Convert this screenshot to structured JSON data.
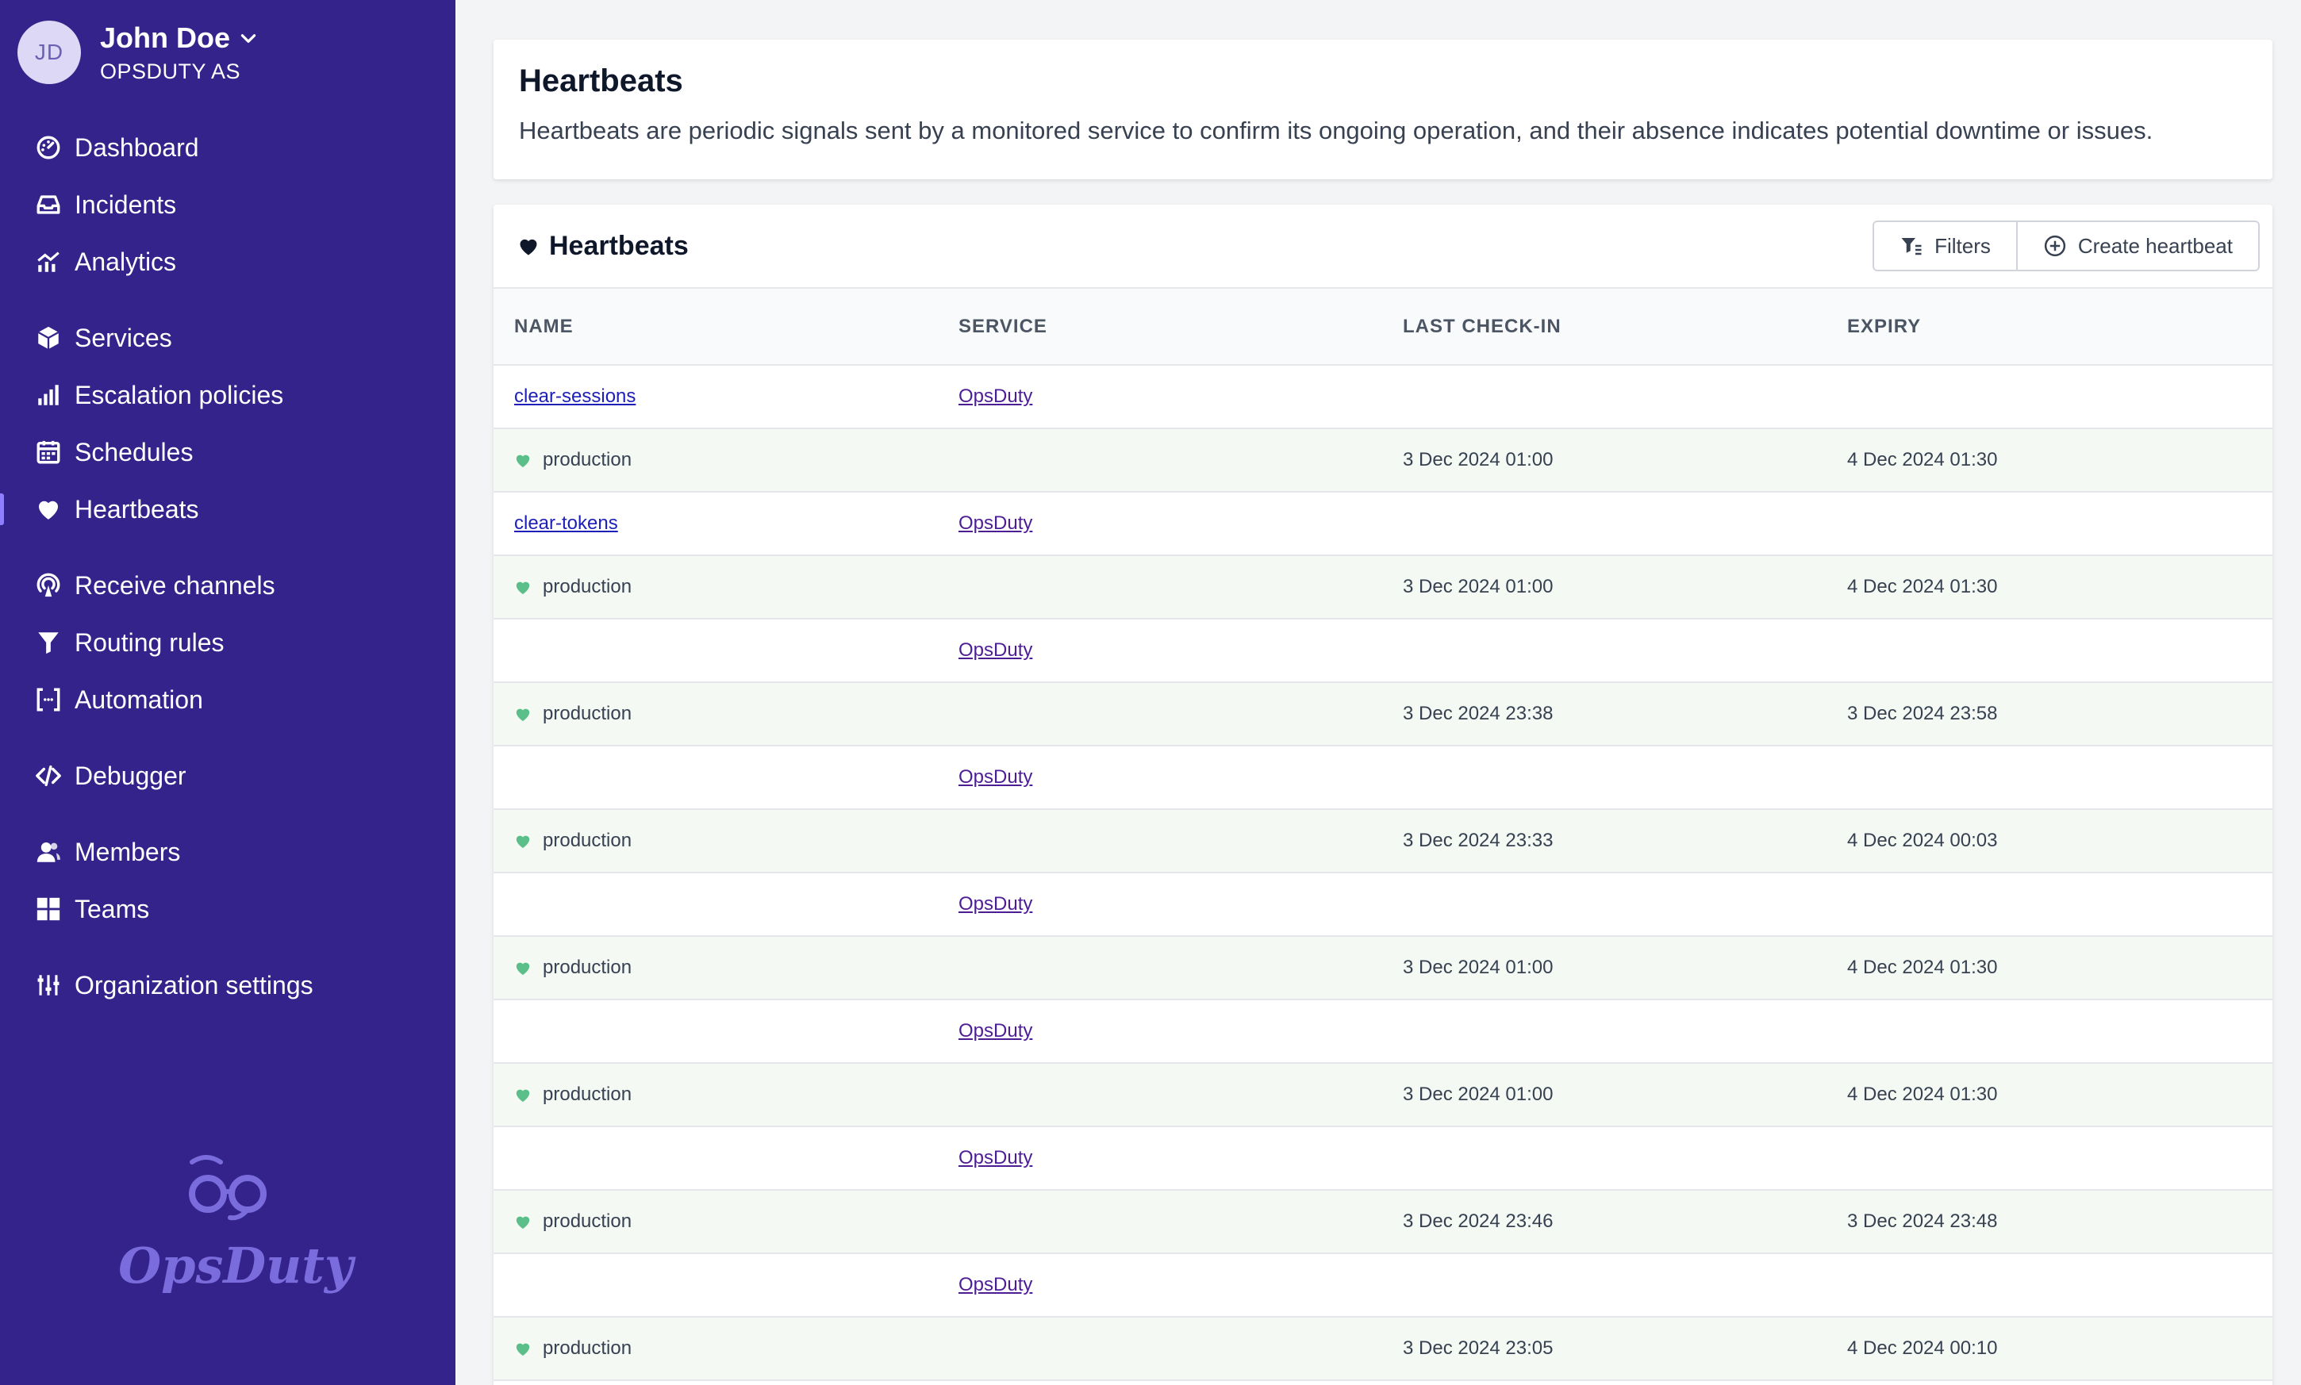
{
  "user": {
    "initials": "JD",
    "name": "John Doe",
    "org": "OPSDUTY AS"
  },
  "nav": {
    "dashboard": "Dashboard",
    "incidents": "Incidents",
    "analytics": "Analytics",
    "services": "Services",
    "escalation": "Escalation policies",
    "schedules": "Schedules",
    "heartbeats": "Heartbeats",
    "receive": "Receive channels",
    "routing": "Routing rules",
    "automation": "Automation",
    "debugger": "Debugger",
    "members": "Members",
    "teams": "Teams",
    "org_settings": "Organization settings"
  },
  "brand": {
    "name": "OpsDuty"
  },
  "info": {
    "title": "Heartbeats",
    "description": "Heartbeats are periodic signals sent by a monitored service to confirm its ongoing operation, and their absence indicates potential downtime or issues."
  },
  "table": {
    "title": "Heartbeats",
    "filters_label": "Filters",
    "create_label": "Create heartbeat",
    "columns": {
      "name": "NAME",
      "service": "SERVICE",
      "last_checkin": "LAST CHECK-IN",
      "expiry": "EXPIRY"
    },
    "rows": [
      {
        "name": "clear-sessions",
        "service": "OpsDuty",
        "env": "production",
        "last": "3 Dec 2024 01:00",
        "expiry": "4 Dec 2024 01:30"
      },
      {
        "name": "clear-tokens",
        "service": "OpsDuty",
        "env": "production",
        "last": "3 Dec 2024 01:00",
        "expiry": "4 Dec 2024 01:30"
      },
      {
        "name": "",
        "service": "OpsDuty",
        "env": "production",
        "last": "3 Dec 2024 23:38",
        "expiry": "3 Dec 2024 23:58"
      },
      {
        "name": "",
        "service": "OpsDuty",
        "env": "production",
        "last": "3 Dec 2024 23:33",
        "expiry": "4 Dec 2024 00:03"
      },
      {
        "name": "",
        "service": "OpsDuty",
        "env": "production",
        "last": "3 Dec 2024 01:00",
        "expiry": "4 Dec 2024 01:30"
      },
      {
        "name": "",
        "service": "OpsDuty",
        "env": "production",
        "last": "3 Dec 2024 01:00",
        "expiry": "4 Dec 2024 01:30"
      },
      {
        "name": "",
        "service": "OpsDuty",
        "env": "production",
        "last": "3 Dec 2024 23:46",
        "expiry": "3 Dec 2024 23:48"
      },
      {
        "name": "",
        "service": "OpsDuty",
        "env": "production",
        "last": "3 Dec 2024 23:05",
        "expiry": "4 Dec 2024 00:10"
      }
    ]
  },
  "colors": {
    "sidebar_bg": "#33238a",
    "brand": "#7b6cdd",
    "healthy": "#5bbf8a",
    "link": "#1d1fb8"
  }
}
